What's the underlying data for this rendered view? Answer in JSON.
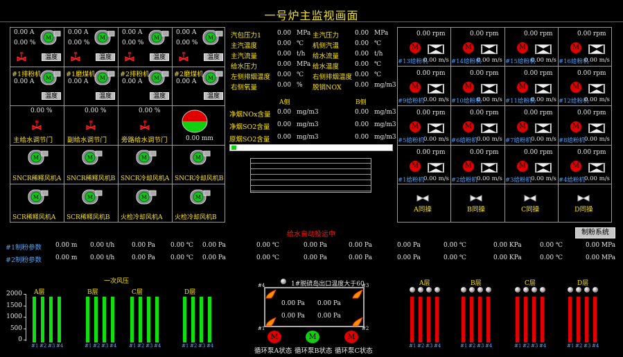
{
  "title": "一号炉主监视画面",
  "left_panel": {
    "row1": [
      {
        "v1": "0.00",
        "u1": "A",
        "v2": "0.00",
        "u2": "%",
        "btn": "温度"
      },
      {
        "v1": "0.00",
        "u1": "A",
        "v2": "0.00",
        "u2": "%",
        "btn": "温度"
      },
      {
        "v1": "0.00",
        "u1": "A",
        "v2": "0.00",
        "u2": "%",
        "btn": "温度"
      },
      {
        "v1": "0.00",
        "u1": "A",
        "v2": "0.00",
        "u2": "%",
        "btn": "温度"
      }
    ],
    "row2": [
      {
        "name": "#1排粉机",
        "v": "0.00",
        "u": "A",
        "btn": "温度"
      },
      {
        "name": "#1磨煤机",
        "v": "0.00",
        "u": "A",
        "btn": "温度"
      },
      {
        "name": "#2排粉机",
        "v": "0.00",
        "u": "A",
        "btn": "温度"
      },
      {
        "name": "#2磨煤机",
        "v": "0.00",
        "u": "A",
        "btn": "温度"
      }
    ],
    "row3": [
      {
        "v": "0.00",
        "u": "%",
        "label": "主给水调节门"
      },
      {
        "v": "0.00",
        "u": "%",
        "label": "副给水调节门"
      },
      {
        "v": "0.00",
        "u": "%",
        "label": "旁路给水调节门"
      },
      {
        "v": "0.00",
        "u": "mm"
      }
    ],
    "row4": [
      "SNCR稀释风机A",
      "SNCR稀释风机B",
      "SNCR冷却风机A",
      "SNCR冷却风机B"
    ],
    "row5": [
      "SCR稀释风机A",
      "SCR稀释风机B",
      "火检冷却风机A",
      "火检冷却风机B"
    ]
  },
  "middle": {
    "params": [
      {
        "l": "汽包压力1",
        "v": "0.00",
        "u": "MPa",
        "l2": "主汽压力",
        "v2": "0.00",
        "u2": "MPa"
      },
      {
        "l": "主汽温度",
        "v": "0.00",
        "u": "℃",
        "l2": "机侧汽温",
        "v2": "0.00",
        "u2": "℃"
      },
      {
        "l": "主汽流量",
        "v": "0.00",
        "u": "t/h",
        "l2": "给水流量",
        "v2": "0.00",
        "u2": "t/h"
      },
      {
        "l": "给水压力",
        "v": "0.00",
        "u": "MPa",
        "l2": "给水温度",
        "v2": "0.00",
        "u2": "℃"
      },
      {
        "l": "左侧排烟温度",
        "v": "0.00",
        "u": "℃",
        "l2": "右侧排烟温度",
        "v2": "0.00",
        "u2": "℃"
      },
      {
        "l": "右侧氧量",
        "v": "0.00",
        "u": "%",
        "l2": "脱销NOX",
        "v2": "0.00",
        "u2": "mg/m3"
      }
    ],
    "side_a": "A侧",
    "side_b": "B侧",
    "emissions": [
      {
        "l": "净烟NOx含量",
        "va": "0.00",
        "ua": "mg/m3",
        "vb": "0.00",
        "ub": "mg/m3"
      },
      {
        "l": "净烟SO2含量",
        "va": "0.00",
        "ua": "mg/m3",
        "vb": "0.00",
        "ub": "mg/m3"
      },
      {
        "l": "原烟SO2含量",
        "va": "0.00",
        "ua": "mg/m3",
        "vb": "0.00",
        "ub": "mg/m3"
      }
    ],
    "progress_fraction": 0.03
  },
  "right_panel": {
    "rows": [
      {
        "labels": [
          "#13给粉机",
          "#14给粉机",
          "#15给粉机",
          "#16给粉机"
        ]
      },
      {
        "labels": [
          "#9给粉机",
          "#10给粉机",
          "#11给粉机",
          "#12给粉机"
        ]
      },
      {
        "labels": [
          "#5给粉机",
          "#6给粉机",
          "#7给粉机",
          "#8给粉机"
        ]
      },
      {
        "labels": [
          "#1给粉机",
          "#2给粉机",
          "#3给粉机",
          "#4给粉机"
        ]
      }
    ],
    "rpm_value": "0.00",
    "rpm_unit": "rpm",
    "speed_value": "0.00",
    "speed_unit": "m/s",
    "sync": [
      "A同操",
      "B同操",
      "C同操",
      "D同操"
    ]
  },
  "alarm_text": "给水自动投运中",
  "system_button": "制粉系统",
  "mill_params": [
    {
      "label": "#1制粉参数",
      "items": [
        "0.00 m",
        "0.00 t/h",
        "0.00 Pa",
        "0.00 ℃",
        "0.00 Pa",
        "0.00 ℃",
        "0.00 Pa",
        "0.00 Pa",
        "0.00 Pa",
        "0.00 ℃",
        "0.00 KPa",
        "0.00 ℃",
        "0.00 MPa"
      ]
    },
    {
      "label": "#2制粉参数",
      "items": [
        "0.00 m",
        "0.00 t/h",
        "0.00 Pa",
        "0.00 ℃",
        "0.00 Pa",
        "0.00 ℃",
        "0.00 Pa",
        "0.00 Pa",
        "0.00 Pa",
        "0.00 ℃",
        "0.00 KPa",
        "0.00 ℃",
        "0.00 MPa"
      ]
    }
  ],
  "bottom_left": {
    "title": "一次风压",
    "yticks": [
      "2000",
      "1500",
      "1000",
      "500",
      "0"
    ],
    "layers": [
      "A层",
      "B层",
      "C层",
      "D层"
    ],
    "bar_labels": [
      "#1",
      "#2",
      "#3",
      "#4"
    ]
  },
  "bottom_center": {
    "header": "1#脱硫岛出口温度大于60",
    "corner_labels": [
      "#4",
      "#3",
      "#1",
      "#2"
    ],
    "values": [
      "0.00 Pa",
      "0.00 Pa",
      "0.00 Pa",
      "0.00 Pa"
    ],
    "pumps": [
      "循环泵A状态",
      "循环泵B状态",
      "循环泵C状态"
    ],
    "pump_glyphs": [
      "M",
      "M",
      "M"
    ]
  },
  "bottom_right": {
    "layers": [
      "A层",
      "B层",
      "C层",
      "D层"
    ],
    "bar_labels": [
      "#1",
      "#2",
      "#3",
      "#4"
    ]
  },
  "colors": {
    "green": "#0fe00f",
    "red": "#e20000",
    "yellow": "#ffe600",
    "blue": "#4fa4ff"
  }
}
